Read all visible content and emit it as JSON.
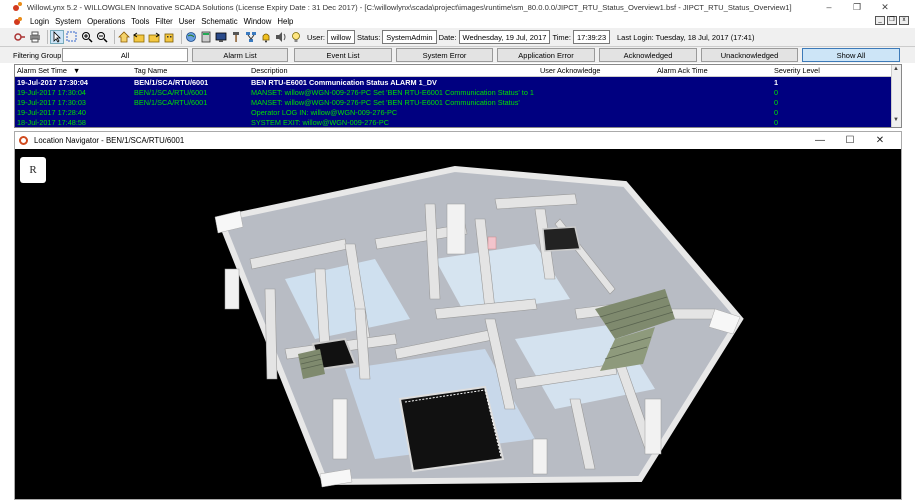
{
  "window": {
    "title": "WillowLynx 5.2 - WILLOWGLEN Innovative SCADA Solutions (License Expiry Date : 31 Dec 2017) - [C:\\willowlynx\\scada\\project\\images\\runtime\\sm_80.0.0.0/JIPCT_RTU_Status_Overview1.bsf - JIPCT_RTU_Status_Overview1]",
    "controls": [
      "–",
      "❐",
      "✕"
    ]
  },
  "menu": [
    "Login",
    "System",
    "Operations",
    "Tools",
    "Filter",
    "User",
    "Schematic",
    "Window",
    "Help"
  ],
  "toolbar": {
    "user_label": "User:",
    "user_value": "willow",
    "status_label": "Status:",
    "status_value": "SystemAdmin",
    "date_label": "Date:",
    "date_value": "Wednesday, 19 Jul, 2017",
    "time_label": "Time:",
    "time_value": "17:39:23",
    "last_login": "Last Login: Tuesday, 18 Jul, 2017 (17:41)"
  },
  "filter": {
    "label": "Filtering Group",
    "buttons": [
      "All",
      "Alarm List",
      "Event List",
      "System Error",
      "Application Error",
      "Acknowledged",
      "Unacknowledged",
      "Show All"
    ]
  },
  "grid": {
    "headers": [
      "Alarm Set Time",
      "Tag Name",
      "Description",
      "User Acknowledge",
      "Alarm Ack Time",
      "Severity Level"
    ],
    "rows": [
      {
        "time": "19-Jul-2017 17:30:04",
        "tag": "BEN/1/SCA/RTU/6001",
        "desc": "BEN RTU-E6001 Communication Status ALARM 1_DV",
        "ack": "",
        "ack_time": "",
        "severity": "1"
      },
      {
        "time": "19-Jul-2017 17:30:04",
        "tag": "BEN/1/SCA/RTU/6001",
        "desc": "MANSET: willow@WGN-009-276-PC Set 'BEN RTU-E6001 Communication Status' to 1",
        "ack": "",
        "ack_time": "",
        "severity": "0"
      },
      {
        "time": "19-Jul-2017 17:30:03",
        "tag": "BEN/1/SCA/RTU/6001",
        "desc": "MANSET: willow@WGN-009-276-PC Set 'BEN RTU-E6001 Communication Status'",
        "ack": "",
        "ack_time": "",
        "severity": "0"
      },
      {
        "time": "19-Jul-2017 17:28:40",
        "tag": "",
        "desc": "Operator LOG IN: willow@WGN-009-276-PC",
        "ack": "",
        "ack_time": "",
        "severity": "0"
      },
      {
        "time": "18-Jul-2017 17:48:58",
        "tag": "",
        "desc": "SYSTEM EXIT: willow@WGN-009-276-PC",
        "ack": "",
        "ack_time": "",
        "severity": "0"
      }
    ]
  },
  "navigator": {
    "title": "Location Navigator - BEN/1/SCA/RTU/6001",
    "reset_label": "R"
  },
  "colors": {
    "grid_bg": "#000080",
    "grid_text": "#00e000",
    "selected_text": "#ffffff",
    "active_filter": "#cde5f7"
  }
}
